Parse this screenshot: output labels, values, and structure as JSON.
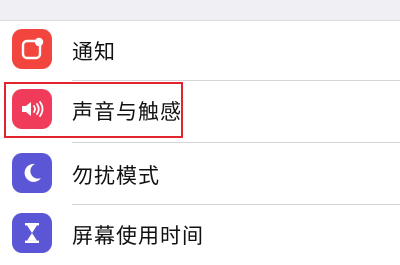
{
  "settings": {
    "items": [
      {
        "label": "通知",
        "icon": "notifications-icon",
        "color": "#f2453d"
      },
      {
        "label": "声音与触感",
        "icon": "sounds-icon",
        "color": "#f03c5a"
      },
      {
        "label": "勿扰模式",
        "icon": "moon-icon",
        "color": "#5b56d6"
      },
      {
        "label": "屏幕使用时间",
        "icon": "hourglass-icon",
        "color": "#5b56d6"
      }
    ],
    "highlight_color": "#e2242f"
  }
}
